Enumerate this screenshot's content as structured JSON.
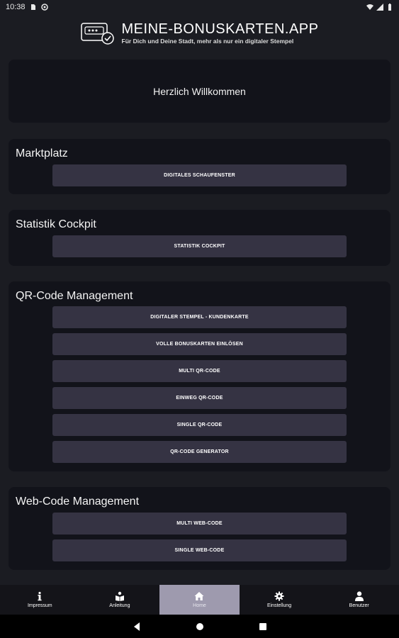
{
  "status_bar": {
    "time": "10:38"
  },
  "header": {
    "title": "MEINE-BONUSKARTEN.APP",
    "subtitle": "Für Dich und Deine Stadt, mehr als nur ein digitaler Stempel"
  },
  "welcome": {
    "text": "Herzlich Willkommen"
  },
  "sections": {
    "marktplatz": {
      "title": "Marktplatz",
      "buttons": [
        "DIGITALES SCHAUFENSTER"
      ]
    },
    "statistik": {
      "title": "Statistik Cockpit",
      "buttons": [
        "STATISTIK COCKPIT"
      ]
    },
    "qr": {
      "title": "QR-Code Management",
      "buttons": [
        "DIGITALER STEMPEL - KUNDENKARTE",
        "VOLLE BONUSKARTEN EINLÖSEN",
        "MULTI QR-CODE",
        "EINWEG QR-CODE",
        "SINGLE QR-CODE",
        "QR-CODE GENERATOR"
      ]
    },
    "web": {
      "title": "Web-Code Management",
      "buttons": [
        "MULTI WEB-CODE",
        "SINGLE WEB-CODE"
      ]
    }
  },
  "bottom_nav": {
    "items": [
      {
        "label": "Impressum",
        "icon": "info-icon"
      },
      {
        "label": "Anleitung",
        "icon": "book-icon"
      },
      {
        "label": "Home",
        "icon": "home-icon",
        "active": true
      },
      {
        "label": "Einstellung",
        "icon": "gear-icon"
      },
      {
        "label": "Benutzer",
        "icon": "user-icon"
      }
    ]
  },
  "colors": {
    "background": "#1b1c22",
    "card": "#12131a",
    "button": "#353343",
    "nav_active": "#9e9aae"
  }
}
